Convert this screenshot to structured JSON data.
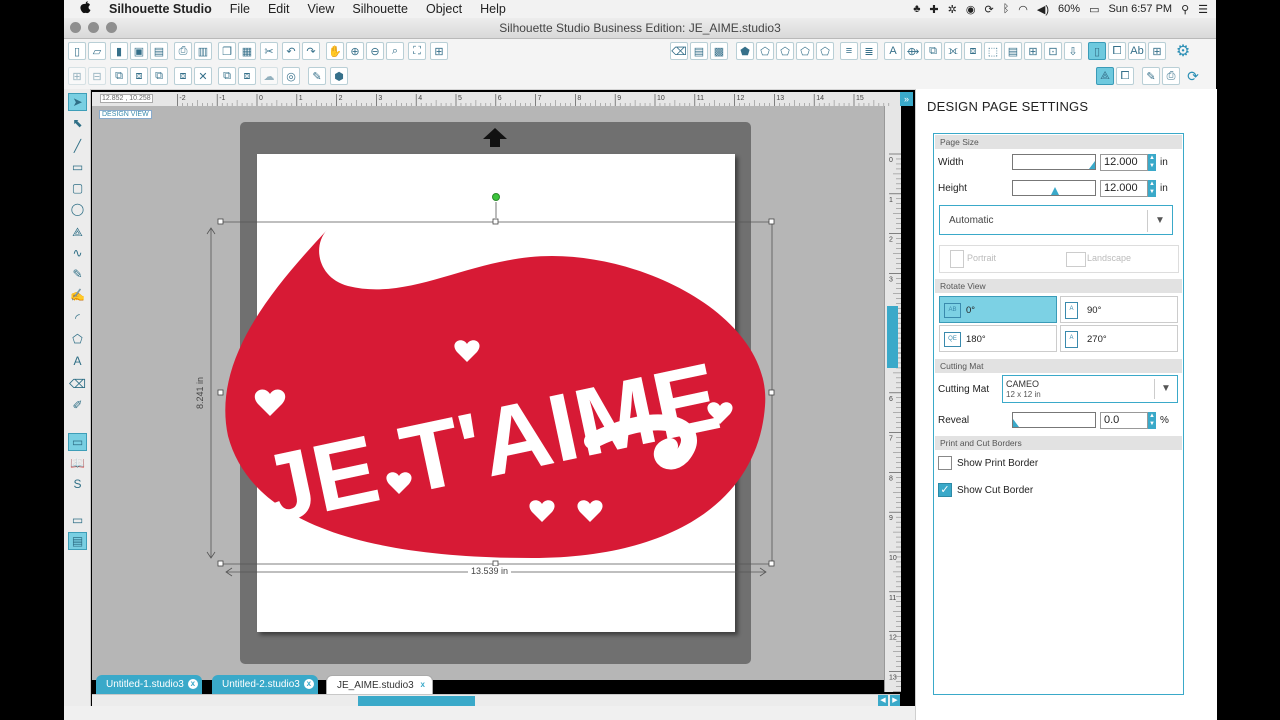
{
  "menubar": {
    "apple": "",
    "app": "Silhouette Studio",
    "items": [
      "File",
      "Edit",
      "View",
      "Silhouette",
      "Object",
      "Help"
    ],
    "status": {
      "battery": "60%",
      "clock": "Sun 6:57 PM"
    }
  },
  "window": {
    "title": "Silhouette Studio Business Edition: JE_AIME.studio3"
  },
  "canvas": {
    "coords": "12.852 , 10.258",
    "design_label": "DESIGN VIEW",
    "height_dim": "8.241 in",
    "width_dim": "13.539 in",
    "artwork_text": "JE T'AIME",
    "ruler_h": [
      "-2",
      "-1",
      "0",
      "1",
      "2",
      "3",
      "4",
      "5",
      "6",
      "7",
      "8",
      "9",
      "10",
      "11",
      "12",
      "13",
      "14",
      "15"
    ],
    "ruler_v": [
      "0",
      "1",
      "2",
      "3",
      "4",
      "5",
      "6",
      "7",
      "8",
      "9",
      "10",
      "11",
      "12",
      "13"
    ]
  },
  "tabs": [
    {
      "label": "Untitled-1.studio3",
      "active": false
    },
    {
      "label": "Untitled-2.studio3",
      "active": false
    },
    {
      "label": "JE_AIME.studio3",
      "active": true
    }
  ],
  "panel": {
    "title": "DESIGN PAGE SETTINGS",
    "page_size": {
      "header": "Page Size",
      "width_label": "Width",
      "width_value": "12.000",
      "height_label": "Height",
      "height_value": "12.000",
      "unit": "in",
      "size_select": "Automatic",
      "portrait": "Portrait",
      "landscape": "Landscape"
    },
    "rotate": {
      "header": "Rotate View",
      "options": [
        "0°",
        "90°",
        "180°",
        "270°"
      ],
      "selected": "0°"
    },
    "cutting_mat": {
      "header": "Cutting Mat",
      "label": "Cutting Mat",
      "value": "CAMEO",
      "sub": "12 x 12 in",
      "reveal_label": "Reveal",
      "reveal_value": "0.0",
      "reveal_unit": "%"
    },
    "borders": {
      "header": "Print and Cut Borders",
      "print_label": "Show Print Border",
      "print_checked": false,
      "cut_label": "Show Cut Border",
      "cut_checked": true
    }
  },
  "colors": {
    "accent": "#3aa9c9",
    "artwork": "#d71a35",
    "mat": "#707070"
  }
}
